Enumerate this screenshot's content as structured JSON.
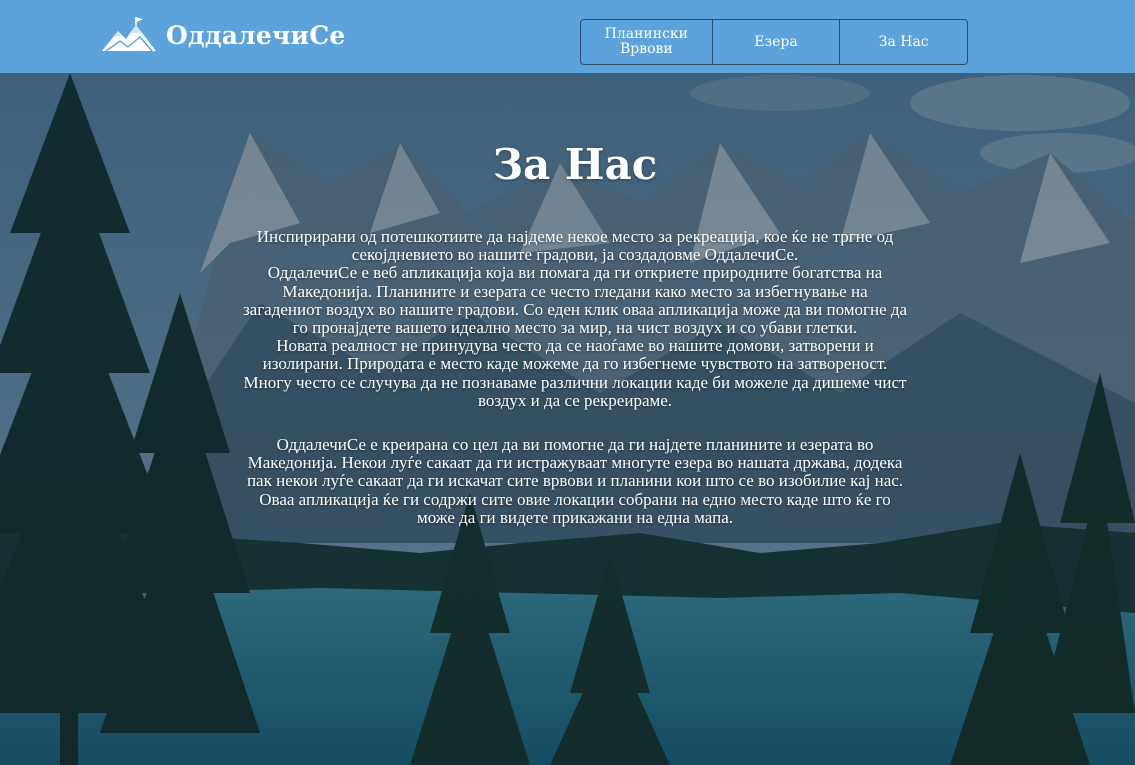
{
  "header": {
    "brand_name": "ОддалечиСе",
    "logo_icon": "mountain-flag-icon",
    "nav": [
      {
        "label": "Планински Врвови"
      },
      {
        "label": "Езера"
      },
      {
        "label": "За Нас"
      }
    ]
  },
  "main": {
    "title": "За Нас",
    "paragraph_1": [
      "Инспирирани од потешкотиите да најдеме некое место за рекреација, кое ќе не тргне од",
      "секојдневието во нашите градови, ја создадовме ОддалечиСе.",
      "ОддалечиСе е веб апликација која ви помага да ги откриете природните богатства на",
      "Македонија. Планините и езерата се често гледани како место за избегнување на",
      "загадениот воздух во нашите градови. Со еден клик оваа апликација може да ви помогне да",
      "го пронајдете вашето идеално место за мир, на чист воздух и со убави глетки.",
      "Новата реалност не принудува често да се наоѓаме во нашите домови, затворени и",
      "изолирани. Природата е место каде можеме да го избегнеме чувството на затвореност.",
      "Многу често се случува да не познаваме различни локации каде би можеле да дишеме чист",
      "воздух и да се рекреираме."
    ],
    "paragraph_2": [
      "ОддалечиСе е креирана со цел да ви помогне да ги најдете планините и езерата во",
      "Македонија. Некои луѓе сакаат да ги истражуваат многуте езера во нашата држава, додека",
      "пак некои луѓе сакаат да ги искачат сите врвови и планини кои што се во изобилие кај нас.",
      "Оваа апликација ќе ги содржи сите овие локации собрани на едно место каде што ќе го",
      "може да ги видете прикажани на една мапа."
    ]
  },
  "colors": {
    "header_bg": "#5ca3dc",
    "nav_border": "#2c4d66",
    "text": "#ffffff"
  }
}
